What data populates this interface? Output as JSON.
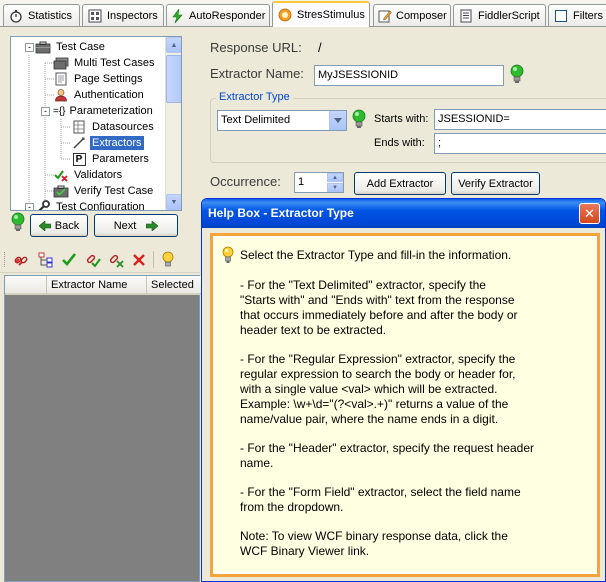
{
  "tabs": [
    {
      "label": "Statistics",
      "icon": "stopwatch-icon"
    },
    {
      "label": "Inspectors",
      "icon": "inspect-icon"
    },
    {
      "label": "AutoResponder",
      "icon": "lightning-icon"
    },
    {
      "label": "StresStimulus",
      "icon": "stresstimulus-icon"
    },
    {
      "label": "Composer",
      "icon": "composer-icon"
    },
    {
      "label": "FiddlerScript",
      "icon": "script-icon"
    },
    {
      "label": "Filters",
      "icon": "checkbox-icon"
    }
  ],
  "tree": {
    "items": [
      {
        "label": "Test Case"
      },
      {
        "label": "Multi Test Cases"
      },
      {
        "label": "Page Settings"
      },
      {
        "label": "Authentication"
      },
      {
        "label": "Parameterization"
      },
      {
        "label": "Datasources"
      },
      {
        "label": "Extractors"
      },
      {
        "label": "Parameters"
      },
      {
        "label": "Validators"
      },
      {
        "label": "Verify Test Case"
      },
      {
        "label": "Test Configuration"
      }
    ],
    "expand_glyph": "-",
    "param_glyph": "={}",
    "p_glyph": "P"
  },
  "nav": {
    "back_label": "Back",
    "next_label": "Next"
  },
  "grid": {
    "columns": [
      "Extractor Name",
      "Selected"
    ]
  },
  "form": {
    "response_url_label": "Response URL:",
    "response_url_value": "/",
    "extractor_name_label": "Extractor Name:",
    "extractor_name_value": "MyJSESSIONID",
    "extractor_type_group": "Extractor Type",
    "extractor_type_value": "Text Delimited",
    "starts_with_label": "Starts with:",
    "starts_with_value": "JSESSIONID=",
    "ends_with_label": "Ends with:",
    "ends_with_value": ";",
    "occurrence_label": "Occurrence:",
    "occurrence_value": "1",
    "add_extractor_label": "Add Extractor",
    "verify_extractor_label": "Verify Extractor"
  },
  "help": {
    "title": "Help Box - Extractor Type",
    "close_glyph": "✕",
    "lines": [
      "Select the Extractor Type and fill-in the information.",
      "- For the \"Text Delimited\" extractor, specify the",
      "\"Starts with\" and \"Ends with\" text from the response",
      "that occurs immediately before and after the body or",
      "header text to be extracted.",
      "- For the \"Regular Expression\" extractor, specify the",
      "regular expression to search the body or header for,",
      "with a single value <val> which will be extracted.",
      "Example: \\w+\\d=\"(?<val>.+)\" returns a value of the",
      "name/value pair, where the name ends in a digit.",
      "- For the \"Header\" extractor, specify the request header",
      "name.",
      "- For the \"Form Field\" extractor, select the field name",
      "from the dropdown.",
      "Note: To view WCF binary response data, click the",
      "WCF Binary Viewer link."
    ]
  },
  "colors": {
    "selection": "#316ac5",
    "help_border": "#f7a33c",
    "help_bg": "#ffffe1",
    "title_blue": "#0055e5",
    "group_label": "#0046d5",
    "bulb_green": "#2fb92f"
  }
}
